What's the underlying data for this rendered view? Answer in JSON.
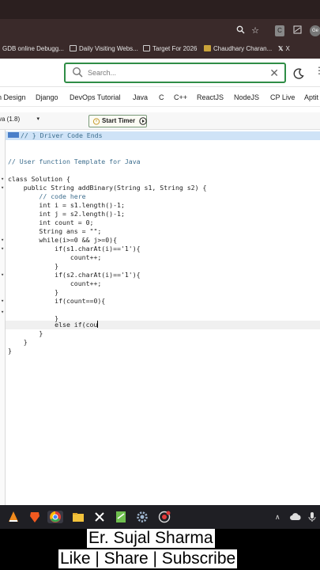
{
  "browser": {
    "bookmarks": [
      {
        "label": "GDB online Debugg...",
        "icon": "site-icon"
      },
      {
        "label": "Daily Visiting Webs...",
        "icon": "folder-icon"
      },
      {
        "label": "Target For 2026",
        "icon": "folder-icon"
      },
      {
        "label": "Chaudhary Charan...",
        "icon": "bookmark-icon"
      },
      {
        "label": "X",
        "icon": "x-icon"
      }
    ]
  },
  "header": {
    "search_placeholder": "Search...",
    "accent": "#2f8d46"
  },
  "nav": {
    "items": [
      "n Design",
      "Django",
      "DevOps Tutorial",
      "Java",
      "C",
      "C++",
      "ReactJS",
      "NodeJS",
      "CP Live",
      "Aptit"
    ]
  },
  "editor": {
    "language": "va (1.8)",
    "timer_label": "Start Timer",
    "code_lines": [
      "// } Driver Code Ends",
      "",
      "",
      "// User function Template for Java",
      "",
      "class Solution {",
      "    public String addBinary(String s1, String s2) {",
      "        // code here",
      "        int i = s1.length()-1;",
      "        int j = s2.length()-1;",
      "        int count = 0;",
      "        String ans = \"\";",
      "        while(i>=0 && j>=0){",
      "            if(s1.charAt(i)=='1'){",
      "                count++;",
      "            }",
      "            if(s2.charAt(i)=='1'){",
      "                count++;",
      "            }",
      "            if(count==0){",
      "",
      "            }",
      "            else if(cou",
      "        }",
      "    }",
      "}"
    ]
  },
  "caption": {
    "name": "Er. Sujal Sharma",
    "cta": "Like | Share | Subscribe"
  }
}
